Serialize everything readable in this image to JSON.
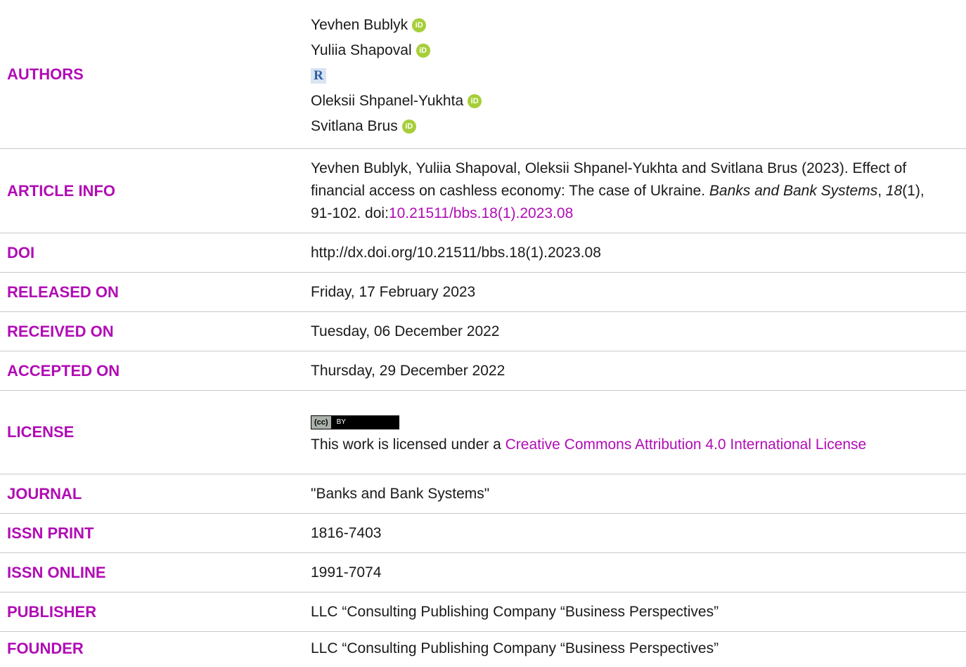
{
  "labels": {
    "authors": "AUTHORS",
    "article_info": "ARTICLE INFO",
    "doi": "DOI",
    "released_on": "RELEASED ON",
    "received_on": "RECEIVED ON",
    "accepted_on": "ACCEPTED ON",
    "license": "LICENSE",
    "journal": "JOURNAL",
    "issn_print": "ISSN PRINT",
    "issn_online": "ISSN ONLINE",
    "publisher": "PUBLISHER",
    "founder": "FOUNDER"
  },
  "authors": [
    {
      "name": "Yevhen Bublyk",
      "icon": "orcid-icon"
    },
    {
      "name": "Yuliia Shapoval",
      "icon": "orcid-icon"
    },
    {
      "name": "",
      "icon": "researchgate-icon"
    },
    {
      "name": "Oleksii Shpanel-Yukhta",
      "icon": "orcid-icon"
    },
    {
      "name": "Svitlana Brus",
      "icon": "orcid-icon"
    }
  ],
  "icons": {
    "orcid_text": "iD",
    "rg_text": "R"
  },
  "article_info": {
    "part1": "Yevhen Bublyk, Yuliia Shapoval, Oleksii Shpanel-Yukhta and Svitlana Brus (2023). Effect of financial access on cashless economy: The case of Ukraine. ",
    "journal_italic": "Banks and Bank Systems",
    "part2": ", ",
    "volume_italic": "18",
    "part3": "(1), 91-102. doi:",
    "doi_link": "10.21511/bbs.18(1).2023.08"
  },
  "doi": "http://dx.doi.org/10.21511/bbs.18(1).2023.08",
  "released_on": "Friday, 17 February 2023",
  "received_on": "Tuesday, 06 December 2022",
  "accepted_on": "Thursday, 29 December 2022",
  "license": {
    "badge_cc": "(cc)",
    "badge_by": "BY",
    "text": "This work is licensed under a ",
    "link": "Creative Commons Attribution 4.0 International License"
  },
  "journal": "\"Banks and Bank Systems\"",
  "issn_print": "1816-7403",
  "issn_online": "1991-7074",
  "publisher": "LLC “Consulting Publishing Company “Business Perspectives”",
  "founder": "LLC “Consulting Publishing Company “Business Perspectives”",
  "colors": {
    "accent": "#b10cb5",
    "orcid": "#a6ce39",
    "divider": "#c9c9c9"
  }
}
